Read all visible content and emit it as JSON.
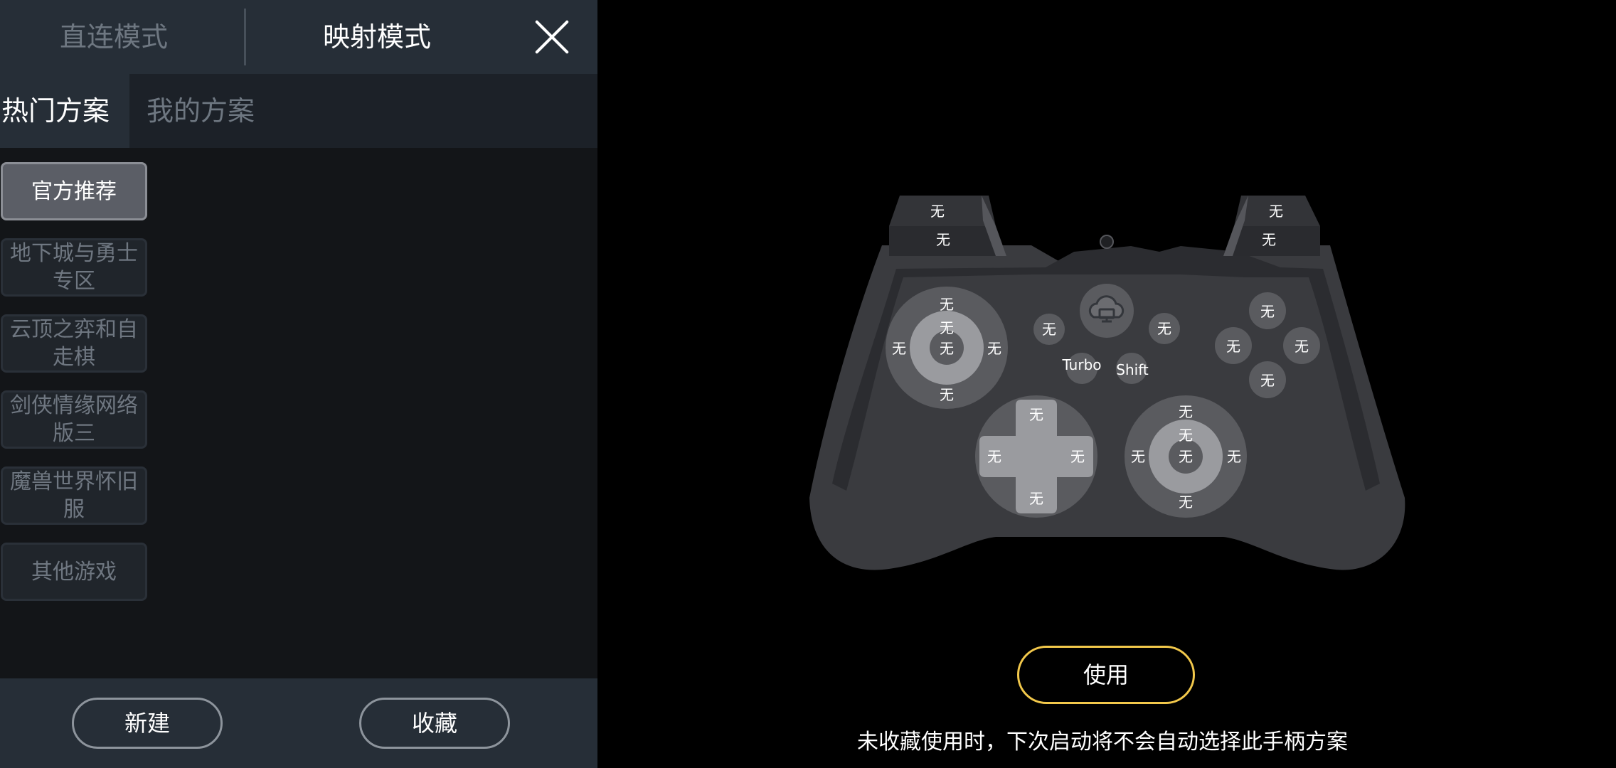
{
  "header": {
    "direct_mode": "直连模式",
    "mapping_mode": "映射模式",
    "close_icon": "close-icon"
  },
  "plan_tabs": {
    "hot": "热门方案",
    "mine": "我的方案"
  },
  "categories": [
    {
      "label": "官方推荐",
      "active": true
    },
    {
      "label": "地下城与勇士专区",
      "active": false
    },
    {
      "label": "云顶之弈和自走棋",
      "active": false
    },
    {
      "label": "剑侠情缘网络版三",
      "active": false
    },
    {
      "label": "魔兽世界怀旧服",
      "active": false
    },
    {
      "label": "其他游戏",
      "active": false
    }
  ],
  "bottom": {
    "new_label": "新建",
    "fav_label": "收藏"
  },
  "gamepad": {
    "unassigned": "无",
    "turbo": "Turbo",
    "shift": "Shift",
    "center_icon": "cloud-monitor-icon"
  },
  "actions": {
    "use_label": "使用",
    "hint": "未收藏使用时，下次启动将不会自动选择此手柄方案"
  },
  "colors": {
    "accent_border": "#f2c84b",
    "panel_bg": "#131518",
    "header_bg": "#262e37"
  }
}
